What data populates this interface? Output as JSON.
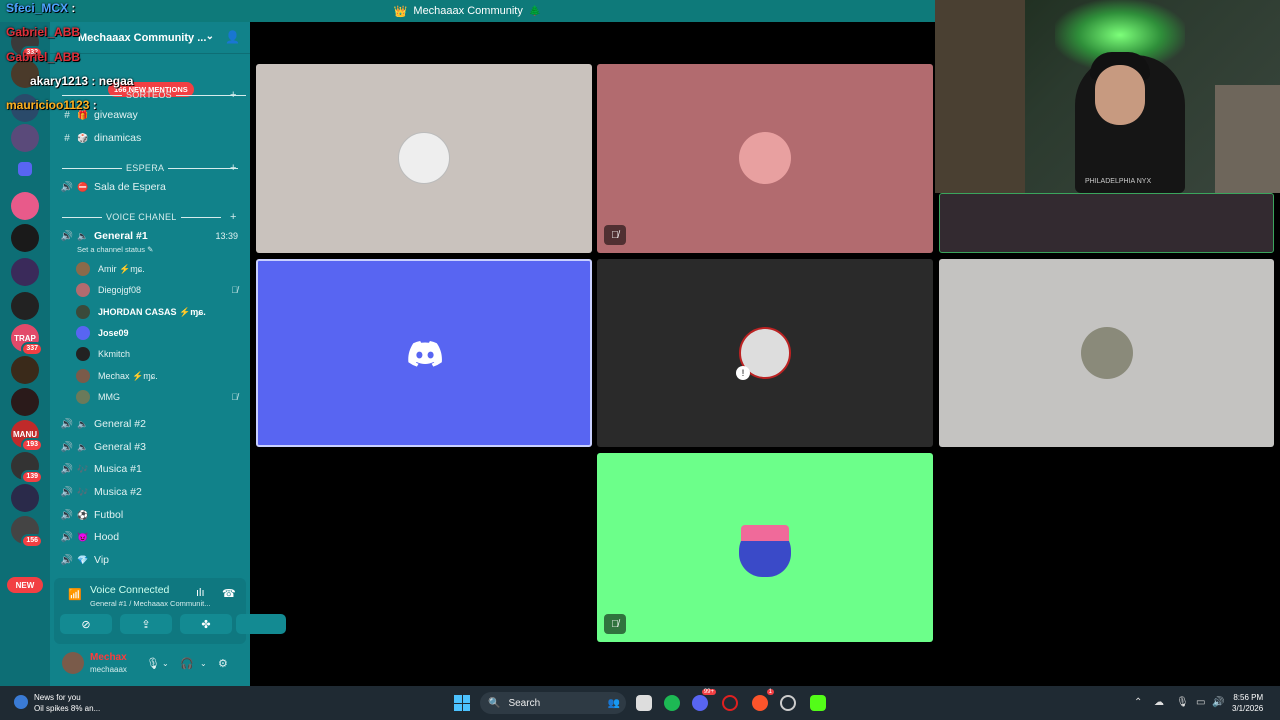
{
  "window": {
    "title": "Mechaaax Community",
    "title_icon": "crown-icon"
  },
  "overlay_chat": [
    {
      "user": "Sfeci_MCX",
      "text": ":",
      "color": "#4da3ff"
    },
    {
      "user": "Gabriel_ABB",
      "text": "",
      "color": "#e0303a"
    },
    {
      "user": "Gabriel_ABB",
      "text": "",
      "color": "#e0303a"
    },
    {
      "user": "akary1213",
      "text": ": negaa",
      "color": "#ffffff"
    },
    {
      "user": "mauricioo1123",
      "text": ":",
      "color": "#ffb020"
    }
  ],
  "servers": [
    {
      "badge": "332"
    },
    {
      "badge": ""
    },
    {
      "badge": ""
    },
    {
      "badge": ""
    },
    {
      "badge": ""
    },
    {
      "badge": ""
    },
    {
      "badge": ""
    },
    {
      "badge": ""
    },
    {
      "badge": ""
    },
    {
      "badge": "337",
      "label": "TRAP"
    },
    {
      "badge": ""
    },
    {
      "badge": ""
    },
    {
      "badge": "193",
      "label": "MANU"
    },
    {
      "badge": "139"
    },
    {
      "badge": ""
    },
    {
      "badge": "156"
    }
  ],
  "new_label": "NEW",
  "guild": {
    "name": "Mechaaax Community ...",
    "mentions": "166 NEW MENTIONS"
  },
  "categories": {
    "sorteos": "SORTEOS",
    "espera": "ESPERA",
    "voice": "VOICE CHANEL"
  },
  "channels": {
    "giveaway": "giveaway",
    "dinamicas": "dinamicas",
    "sala_espera": "Sala de Espera",
    "general1": "General #1",
    "general1_timer": "13:39",
    "channel_status": "Set a channel status",
    "general2": "General #2",
    "general3": "General #3",
    "musica1": "Musica #1",
    "musica2": "Musica #2",
    "futbol": "Futbol",
    "hood": "Hood",
    "vip": "Vip"
  },
  "members": [
    {
      "name": "Amir",
      "suffix": "⚡ɱɕ.",
      "muted": false,
      "bold": false
    },
    {
      "name": "Diegojgf08",
      "suffix": "",
      "muted": true,
      "bold": false
    },
    {
      "name": "JHORDAN CASAS",
      "suffix": "⚡ɱɕ.",
      "muted": false,
      "bold": true
    },
    {
      "name": "Jose09",
      "suffix": "",
      "muted": false,
      "bold": true
    },
    {
      "name": "Kkmitch",
      "suffix": "",
      "muted": false,
      "bold": false
    },
    {
      "name": "Mechax",
      "suffix": "⚡ɱɕ.",
      "muted": false,
      "bold": false
    },
    {
      "name": "MMG",
      "suffix": "",
      "muted": true,
      "bold": false
    }
  ],
  "voice_panel": {
    "status": "Voice Connected",
    "location": "General #1 / Mechaaax Communit..."
  },
  "user": {
    "name": "Mechax",
    "handle": "mechaaax"
  },
  "stage": {
    "tiles": [
      {
        "bg": "#c9c2bd",
        "muted": false
      },
      {
        "bg": "#b26b6f",
        "muted": true
      },
      {
        "bg": "#5865f2",
        "muted": false
      },
      {
        "bg": "#2a2a2a",
        "muted": false
      },
      {
        "bg": "#c4c3c1",
        "muted": false
      },
      {
        "bg": "#6cff8a",
        "muted": true
      }
    ]
  },
  "webcam": {
    "shirt_text": "PHILADELPHIA NYX"
  },
  "taskbar": {
    "news_title": "News for you",
    "news_sub": "Oil spikes 8% an...",
    "search": "Search",
    "time": "8:56 PM",
    "date": "3/1/2026",
    "discord_badge": "99+",
    "brave_badge": "1"
  },
  "colors": {
    "sidebar": "#11828a",
    "rail": "#0d6e75",
    "titlebar": "#0e7a7a",
    "blurple": "#5865f2",
    "danger": "#f23f43"
  }
}
